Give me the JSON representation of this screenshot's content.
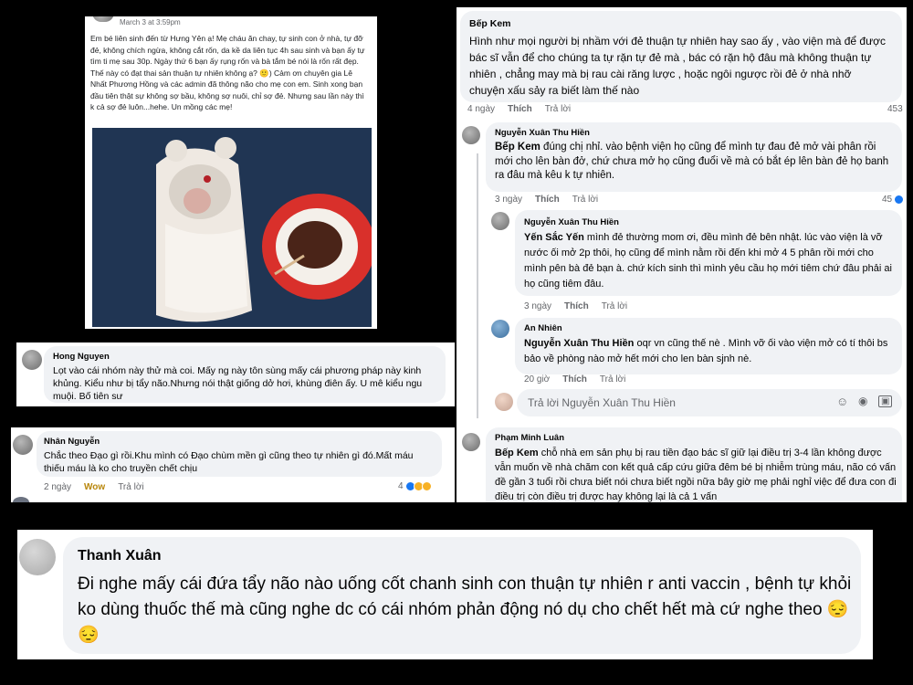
{
  "post": {
    "timestamp": "March 3 at 3:59pm",
    "text": "Em bé liên sinh đến từ Hưng Yên ạ! Mẹ cháu ăn chay, tự sinh con ở nhà, tự đỡ đẻ, không chích ngừa, không cắt rốn, da kề da liên tục 4h sau sinh và bạn ấy tự tìm ti mẹ sau 30p. Ngày thứ 6 bạn ấy rụng rốn và bà tắm bé nói là rốn rất đẹp. Thế này có đạt thai sản thuận tự nhiên không ạ? 🙂) Cảm ơn chuyên gia Lê Nhất Phương Hồng và các admin đã thông não cho mẹ con em. Sinh xong bạn đầu tiên thật sự không sợ bầu, không sợ nuôi, chỉ sợ đẻ. Nhưng sau lần này thì k cả sợ đẻ luôn...hehe. Un mồng các mẹ!"
  },
  "comments": {
    "hong": {
      "name": "Hong Nguyen",
      "text": "Lọt vào cái nhóm này thử mà coi. Mấy ng này tôn sùng mấy cái phương pháp này kinh khủng. Kiểu như bị tẩy não.Nhưng nói thật giống dở hơi, khùng điên ấy. U mê kiểu ngu muội. Bố tiên sư"
    },
    "nhan": {
      "name": "Nhân Nguyễn",
      "text": "Chắc theo Đạo gì rồi.Khu mình có Đạo chùm mền gì cũng theo tự nhiên gì đó.Mất máu thiếu máu là ko cho truyền chết chịu",
      "time": "2 ngày",
      "reaction": "Wow",
      "reply": "Trả lời",
      "count": "4"
    },
    "bepkem": {
      "name": "Bếp Kem",
      "text": "Hình như mọi người bị nhầm với đẻ thuận tự nhiên hay sao ấy , vào viện mà để được bác sĩ vẫn để cho chúng ta tự rặn tự đẻ mà , bác có rặn hộ đâu mà không thuận tự nhiên , chẳng may mà bị rau cài răng lược , hoặc ngôi ngược rồi đẻ ở nhà nhỡ chuyện xấu sảy ra biết làm thế nào",
      "time": "4 ngày",
      "like": "Thích",
      "reply": "Trả lời",
      "count": "453"
    },
    "hien1": {
      "name": "Nguyễn Xuân Thu Hiền",
      "tag": "Bếp Kem",
      "text": " đúng chị nhỉ. vào bệnh viện họ cũng để mình tự đau đẻ mở vài phân rồi mới cho lên bàn đở, chứ chưa mở họ cũng đuổi về mà có bắt ép lên bàn đẻ họ banh ra đâu mà kêu k tự nhiên.",
      "time": "3 ngày",
      "like": "Thích",
      "reply": "Trả lời",
      "count": "45"
    },
    "hien2": {
      "name": "Nguyễn Xuân Thu Hiền",
      "tag": "Yến Sắc Yến",
      "text": " mình đẻ thường mom ơi, đều mình đẻ bên nhật. lúc vào viện là vỡ nước ối mở 2p thôi, họ cũng để mình nằm rồi đến khi mở 4 5 phân rồi mới cho mình pên bà đẻ bạn à. chứ kích sinh thì mình yêu cầu họ mới tiêm chứ đâu phải ai họ cũng tiêm đâu.",
      "time": "3 ngày",
      "like": "Thích",
      "reply": "Trả lời"
    },
    "annhien": {
      "name": "An Nhiên",
      "tag": "Nguyễn Xuân Thu Hiền",
      "text": " oqr vn cũng thế nè . Mình vỡ ối vào viện mở có tí thôi bs bảo về phòng nào mở hết mới cho len bàn sjnh nè.",
      "time": "20 giờ",
      "like": "Thích",
      "reply": "Trả lời"
    },
    "replybox": {
      "placeholder": "Trả lời Nguyễn Xuân Thu Hiền"
    },
    "luan": {
      "name": "Phạm Minh Luân",
      "tag": "Bếp Kem",
      "text": " chỗ nhà em sản phụ bị rau tiền đạo bác sĩ giữ lại điều trị 3-4 lần không được vẫn muốn về nhà chăm con kết quả cấp cứu giữa đêm bé bị nhiễm trùng máu, não có vấn đề gần 3 tuổi rồi chưa biết nói chưa biết ngồi nữa bây giờ mẹ phải nghỉ việc để đưa con đi điều trị còn điều trị được hay không lại là cả 1 vấn"
    },
    "thanh": {
      "name": "Thanh Xuân",
      "text": "Đi nghe mấy cái đứa tẩy não nào uống cốt chanh sinh con thuận tự nhiên r anti vaccin , bệnh tự khỏi ko dùng thuốc thế mà cũng nghe dc có cái nhóm phản động nó dụ cho chết hết mà cứ nghe theo 😔😔"
    }
  }
}
